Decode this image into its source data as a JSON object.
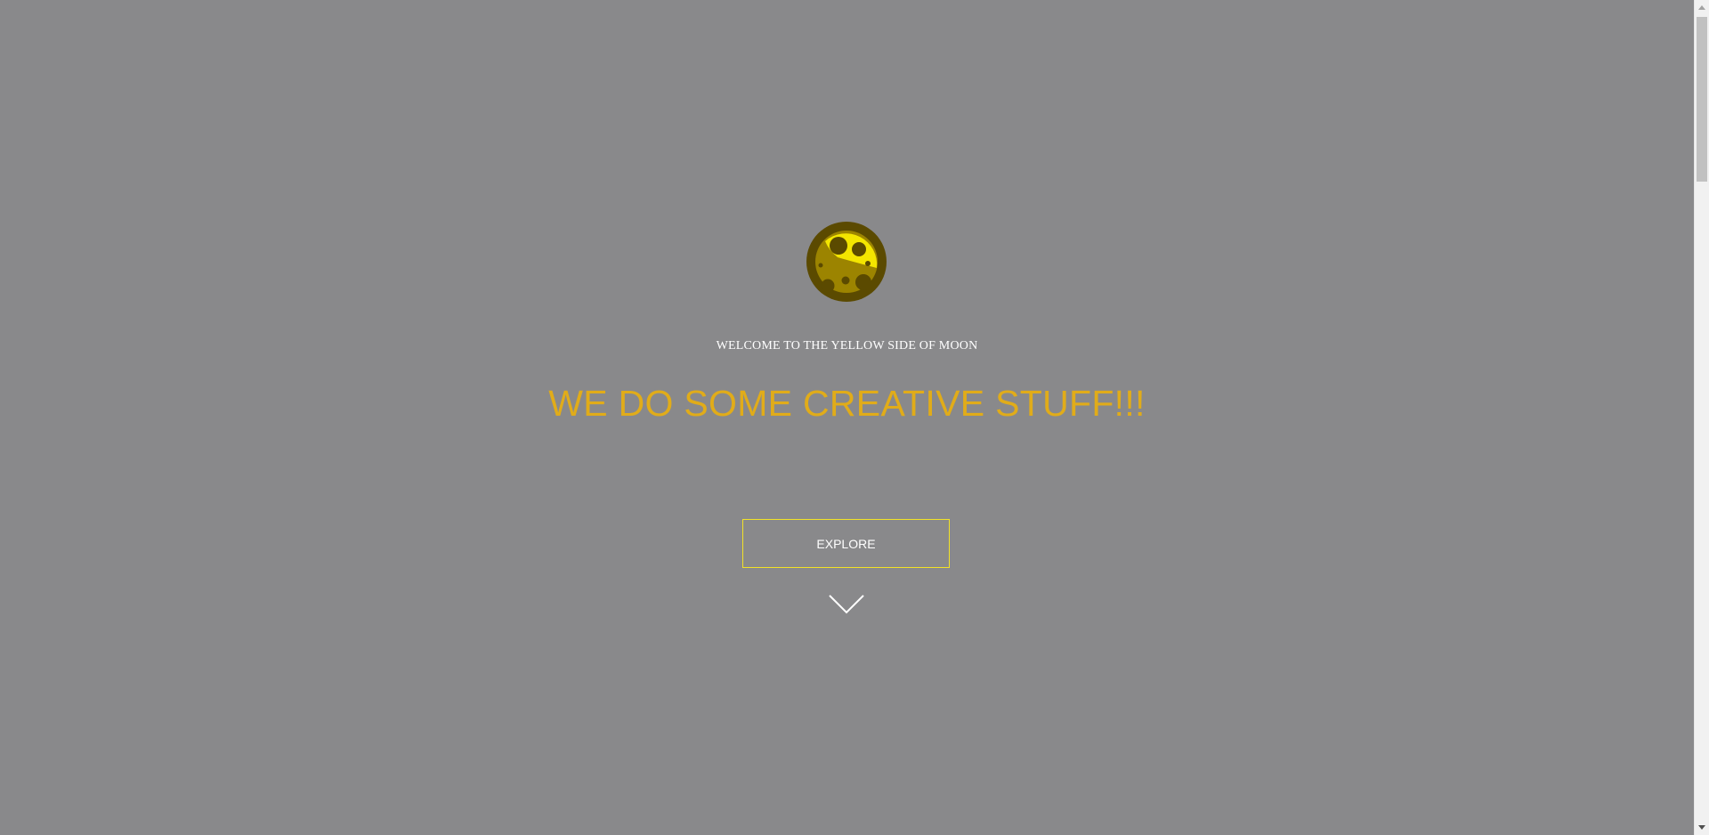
{
  "hero": {
    "logo_icon": "moon-logo-icon",
    "welcome_text": "WELCOME TO THE YELLOW SIDE OF MOON",
    "headline": "WE DO SOME CREATIVE STUFF!!!",
    "explore_label": "EXPLORE",
    "scroll_icon": "chevron-down-icon"
  },
  "colors": {
    "background": "#89898b",
    "headline": "#e1ac19",
    "button_border": "#f2e227",
    "moon_yellow": "#f3e500",
    "moon_dark": "#5b4a00"
  },
  "scrollbar": {
    "up_icon": "arrow-up-icon",
    "down_icon": "arrow-down-icon"
  }
}
